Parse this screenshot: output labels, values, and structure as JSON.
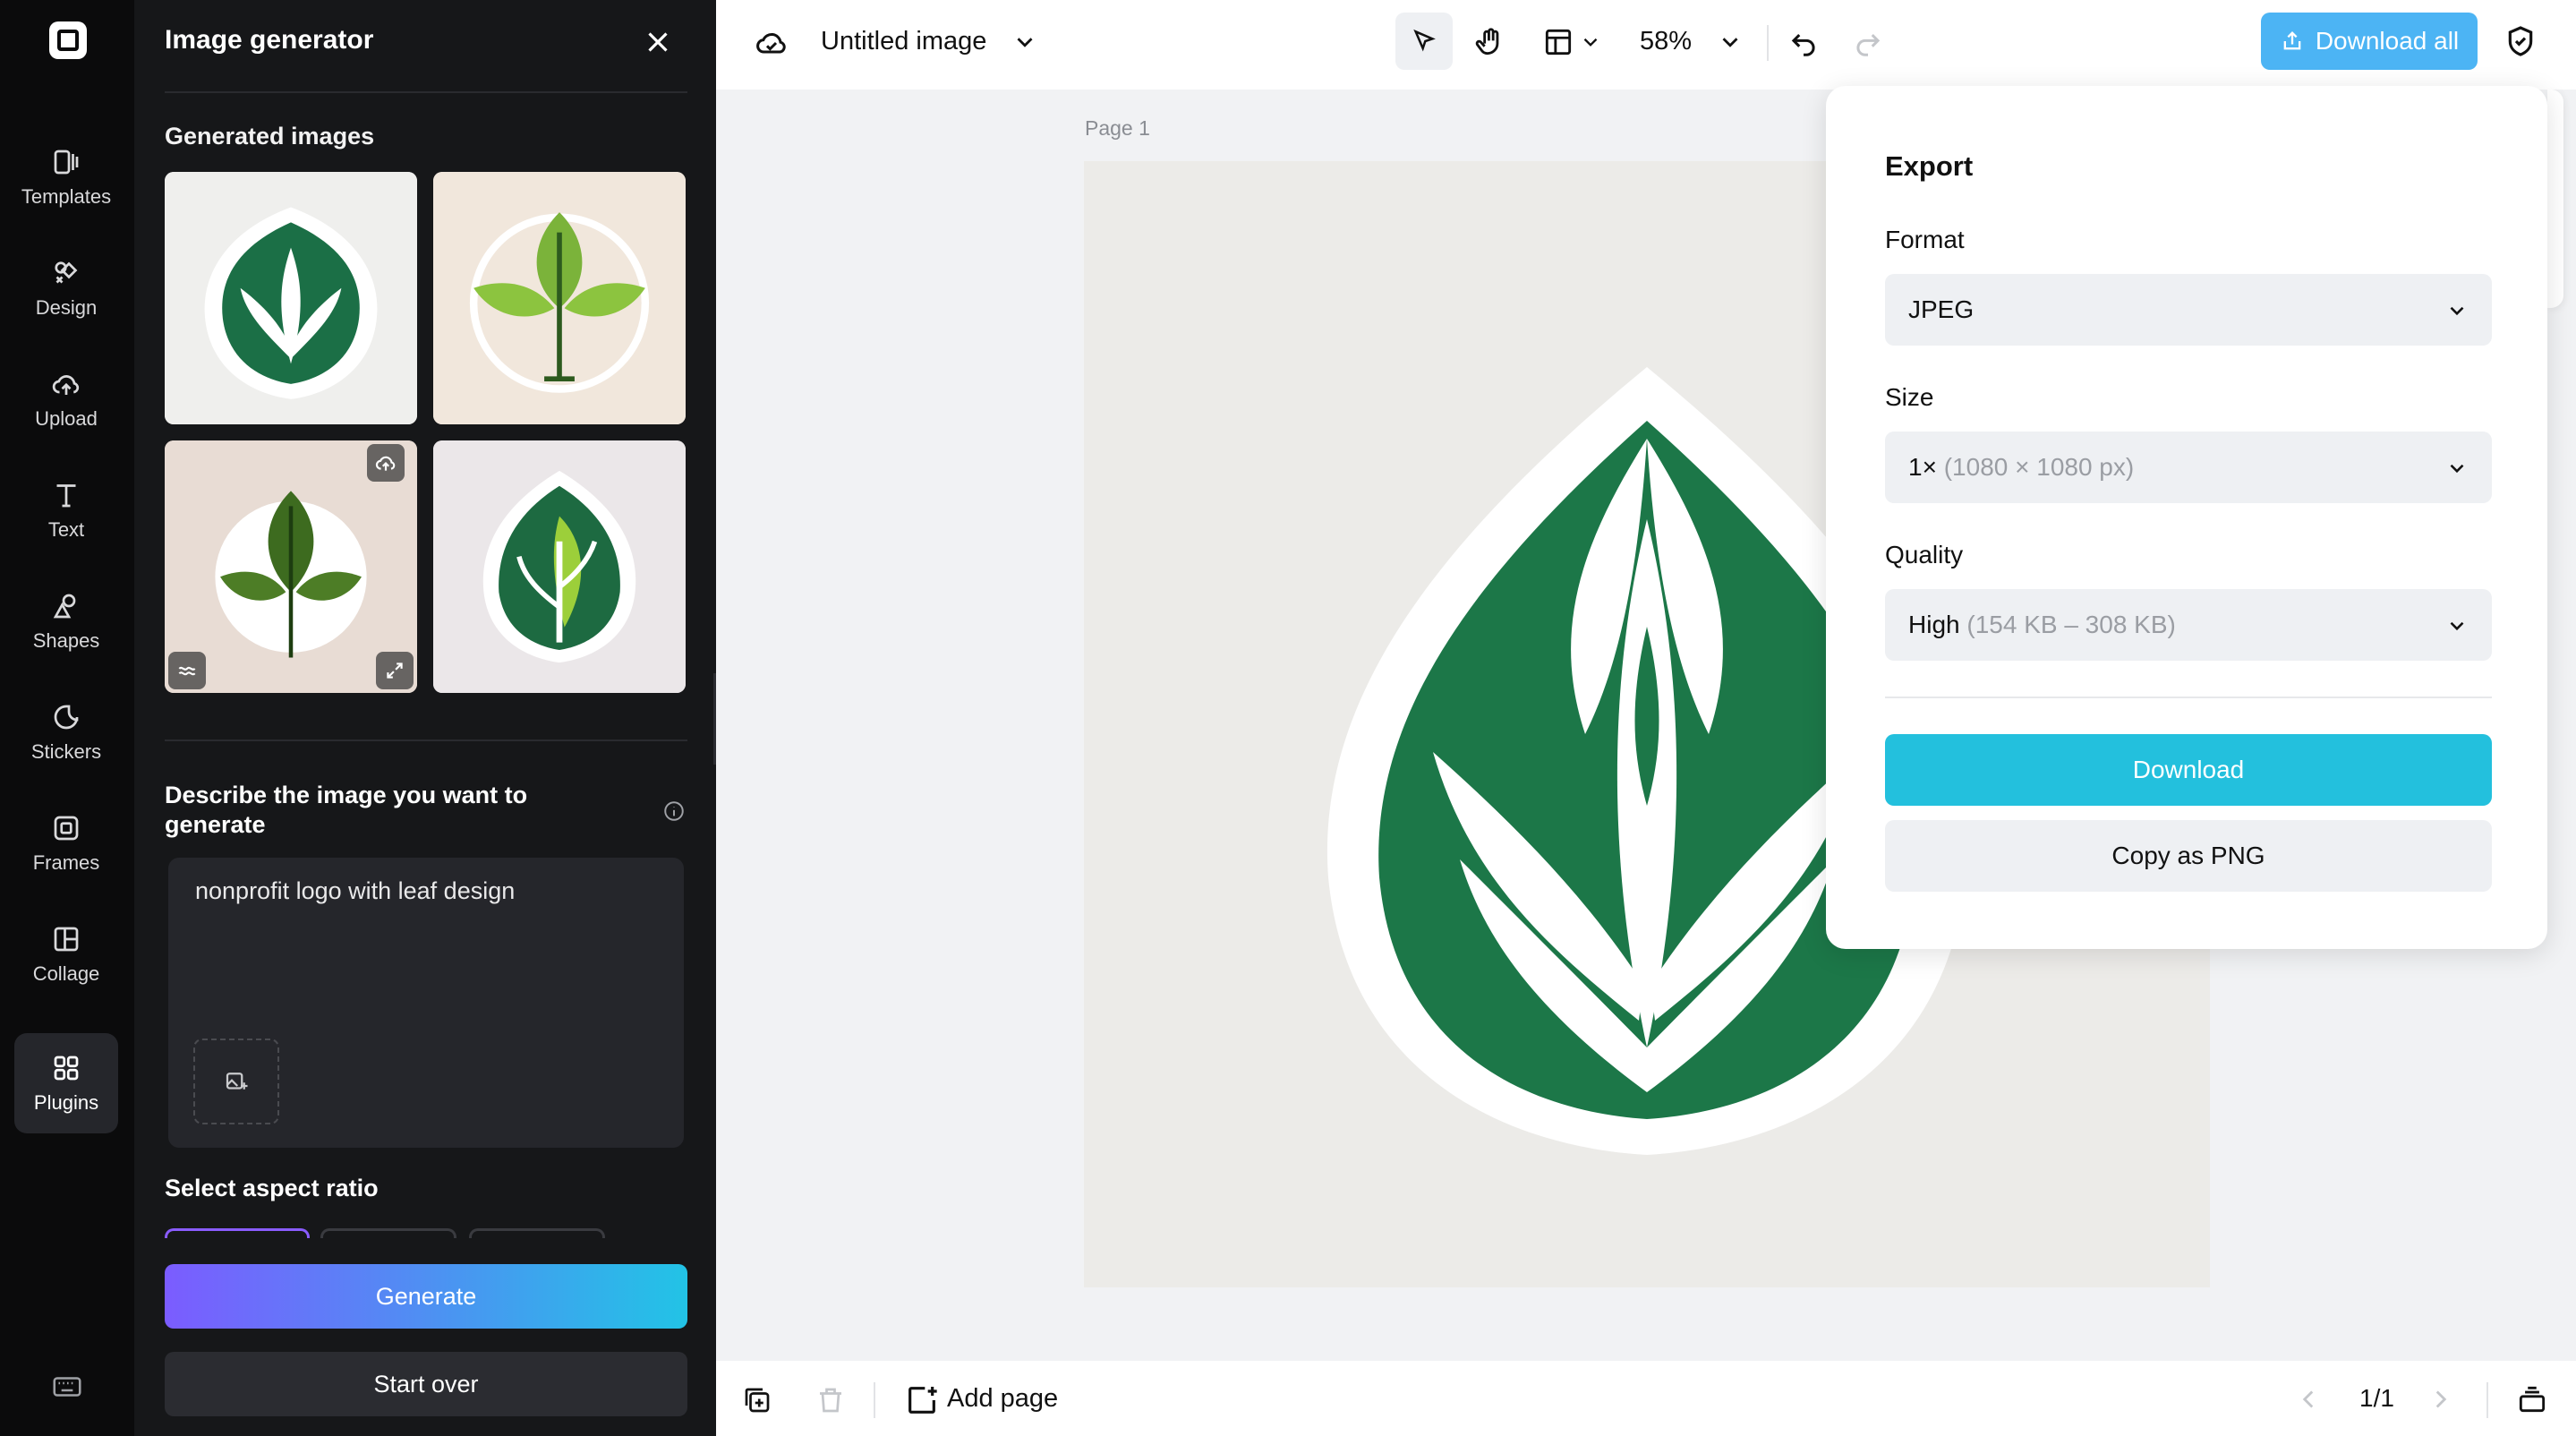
{
  "rail": {
    "items": [
      {
        "label": "Templates",
        "icon": "templates-icon"
      },
      {
        "label": "Design",
        "icon": "design-icon"
      },
      {
        "label": "Upload",
        "icon": "upload-cloud-icon"
      },
      {
        "label": "Text",
        "icon": "text-icon"
      },
      {
        "label": "Shapes",
        "icon": "shapes-icon"
      },
      {
        "label": "Stickers",
        "icon": "stickers-icon"
      },
      {
        "label": "Frames",
        "icon": "frames-icon"
      },
      {
        "label": "Collage",
        "icon": "collage-icon"
      },
      {
        "label": "Plugins",
        "icon": "plugins-icon"
      }
    ]
  },
  "panel": {
    "title": "Image generator",
    "generated_label": "Generated images",
    "prompt_label": "Describe the image you want to generate",
    "prompt_value": "nonprofit logo with leaf design",
    "aspect_label": "Select aspect ratio",
    "generate_label": "Generate",
    "start_over_label": "Start over"
  },
  "topbar": {
    "title": "Untitled image",
    "zoom": "58%",
    "download_all": "Download all"
  },
  "canvas": {
    "page_label": "Page 1"
  },
  "bottombar": {
    "add_page": "Add page",
    "pager": "1/1"
  },
  "export": {
    "title": "Export",
    "format_label": "Format",
    "format_value": "JPEG",
    "size_label": "Size",
    "size_value": "1×",
    "size_detail": "(1080 × 1080 px)",
    "quality_label": "Quality",
    "quality_value": "High",
    "quality_detail": "(154 KB – 308 KB)",
    "download_label": "Download",
    "copy_label": "Copy as PNG"
  },
  "colors": {
    "accent_cyan": "#23c0dd",
    "download_all_blue": "#4cb4f4",
    "leaf_green": "#1e7a4a"
  }
}
